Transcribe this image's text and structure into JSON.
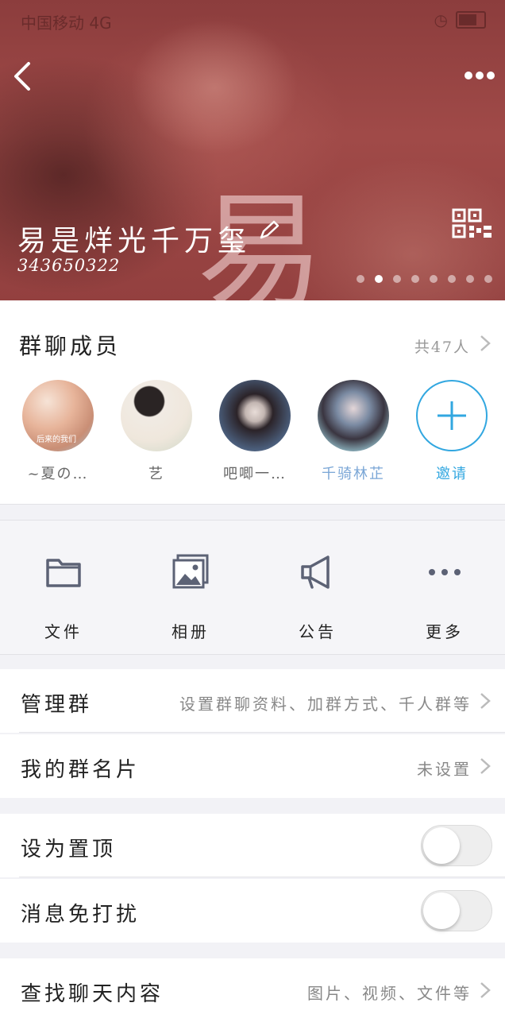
{
  "status_bar": {
    "left_text": "中国移动 4G",
    "right_text": ""
  },
  "header": {
    "group_name": "易是烊光千万玺",
    "group_id": "343650322",
    "watermark_char": "易",
    "carousel_dots": 8,
    "active_dot": 1
  },
  "members": {
    "title": "群聊成员",
    "count_label": "共47人",
    "items": [
      {
        "name": "~夏の…",
        "avatar_caption": "后来的我们"
      },
      {
        "name": "艺"
      },
      {
        "name": "吧唧一…"
      },
      {
        "name": "千骑林芷"
      }
    ],
    "invite_label": "邀请"
  },
  "tools": [
    {
      "label": "文件",
      "icon": "folder-icon"
    },
    {
      "label": "相册",
      "icon": "album-icon"
    },
    {
      "label": "公告",
      "icon": "megaphone-icon"
    },
    {
      "label": "更多",
      "icon": "more-dots-icon"
    }
  ],
  "settings": {
    "manage": {
      "label": "管理群",
      "value": "设置群聊资料、加群方式、千人群等"
    },
    "card": {
      "label": "我的群名片",
      "value": "未设置"
    },
    "pin": {
      "label": "设为置顶",
      "on": false
    },
    "mute": {
      "label": "消息免打扰",
      "on": false
    },
    "search": {
      "label": "查找聊天内容",
      "value": "图片、视频、文件等"
    }
  },
  "colors": {
    "accent": "#32a7e0",
    "header_tint": "#9a4545"
  }
}
